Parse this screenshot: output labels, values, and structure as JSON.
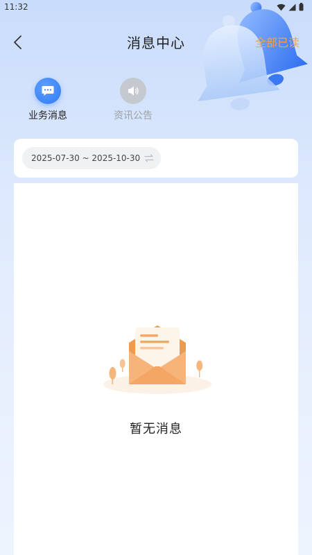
{
  "status_bar": {
    "time": "11:32"
  },
  "header": {
    "title": "消息中心",
    "mark_all_read": "全部已读"
  },
  "tabs": [
    {
      "label": "业务消息",
      "icon": "chat-bubble-icon",
      "active": true
    },
    {
      "label": "资讯公告",
      "icon": "speaker-icon",
      "active": false
    }
  ],
  "filter": {
    "date_range": "2025-07-30 ~ 2025-10-30"
  },
  "empty_state": {
    "text": "暂无消息"
  },
  "colors": {
    "accent": "#2f7af5",
    "mark_all": "#f0a54a",
    "illustration": "#f6a95a"
  }
}
